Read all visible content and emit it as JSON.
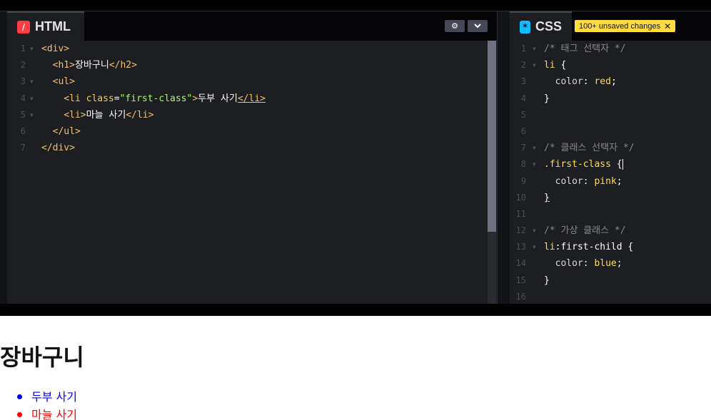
{
  "html_panel": {
    "tab_label": "HTML",
    "icon": "html-icon",
    "settings_icon": "gear-icon",
    "collapse_icon": "chevron-down-icon",
    "lines": [
      {
        "n": "1",
        "fold": true
      },
      {
        "n": "2",
        "fold": false
      },
      {
        "n": "3",
        "fold": true
      },
      {
        "n": "4",
        "fold": true
      },
      {
        "n": "5",
        "fold": true
      },
      {
        "n": "6",
        "fold": false
      },
      {
        "n": "7",
        "fold": false
      }
    ],
    "code": {
      "l1_open": "<div>",
      "l2_open": "<h1>",
      "l2_text": "장바구니",
      "l2_close": "</h2>",
      "l3_open": "<ul>",
      "l4_tag_open": "<li ",
      "l4_attr": "class",
      "l4_eq": "=",
      "l4_str": "\"first-class\"",
      "l4_gt": ">",
      "l4_text": "두부 사기",
      "l4_close": "</li>",
      "l5_open": "<li>",
      "l5_text": "마늘 사기",
      "l5_close": "</li>",
      "l6_close": "</ul>",
      "l7_close": "</div>"
    }
  },
  "css_panel": {
    "tab_label": "CSS",
    "icon": "css-icon",
    "unsaved_badge": "100+ unsaved changes",
    "close_icon": "close-icon",
    "lines": [
      "1",
      "2",
      "3",
      "4",
      "5",
      "6",
      "7",
      "8",
      "9",
      "10",
      "11",
      "12",
      "13",
      "14",
      "15",
      "16"
    ],
    "code": {
      "c1": "/* 태그 선택자 */",
      "c2_sel": "li",
      "c2_brace": " {",
      "c3_prop": "color",
      "c3_colon": ": ",
      "c3_val": "red",
      "c3_semi": ";",
      "c4": "}",
      "c7": "/* 클래스 선택자 */",
      "c8_sel": ".first-class",
      "c8_brace": " {",
      "c9_prop": "color",
      "c9_colon": ": ",
      "c9_val": "pink",
      "c9_semi": ";",
      "c10": "}",
      "c12": "/* 가상 클래스 */",
      "c13_sel": "li",
      "c13_pseudo": ":first-child",
      "c13_brace": " {",
      "c14_prop": "color",
      "c14_colon": ": ",
      "c14_val": "blue",
      "c14_semi": ";",
      "c15": "}"
    }
  },
  "preview": {
    "heading": "장바구니",
    "items": [
      {
        "text": "두부 사기",
        "color": "#0000ff"
      },
      {
        "text": "마늘 사기",
        "color": "#ff0000"
      }
    ]
  },
  "colors": {
    "html_accent": "#ff3c41",
    "css_accent": "#0ebeff",
    "badge": "#ffdd40"
  }
}
